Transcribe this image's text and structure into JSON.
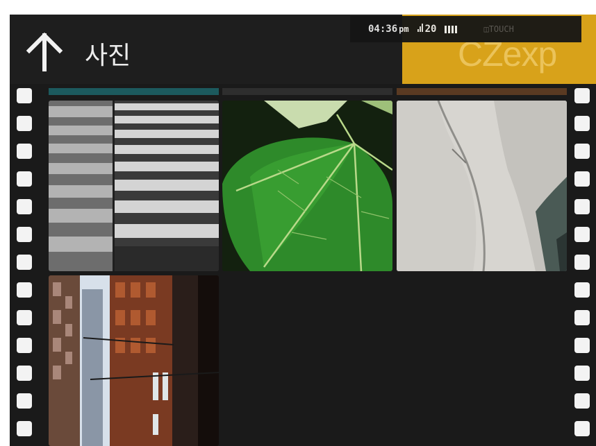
{
  "header": {
    "title": "사진",
    "back_icon": "arrow-up-icon"
  },
  "brand": {
    "text": "CZexp",
    "color": "#d8a21a"
  },
  "status_bar": {
    "time": "04:36",
    "ampm": "pm",
    "signal_value": "20",
    "lock_label": "TOUCH"
  },
  "gallery": {
    "photos": [
      {
        "subject": "crosswalk"
      },
      {
        "subject": "green-leaf"
      },
      {
        "subject": "white-fabric"
      },
      {
        "subject": "city-alley"
      }
    ]
  },
  "colors": {
    "background": "#1a1a1a",
    "header": "#1e1e1e",
    "perforation": "#f3f3f3"
  }
}
